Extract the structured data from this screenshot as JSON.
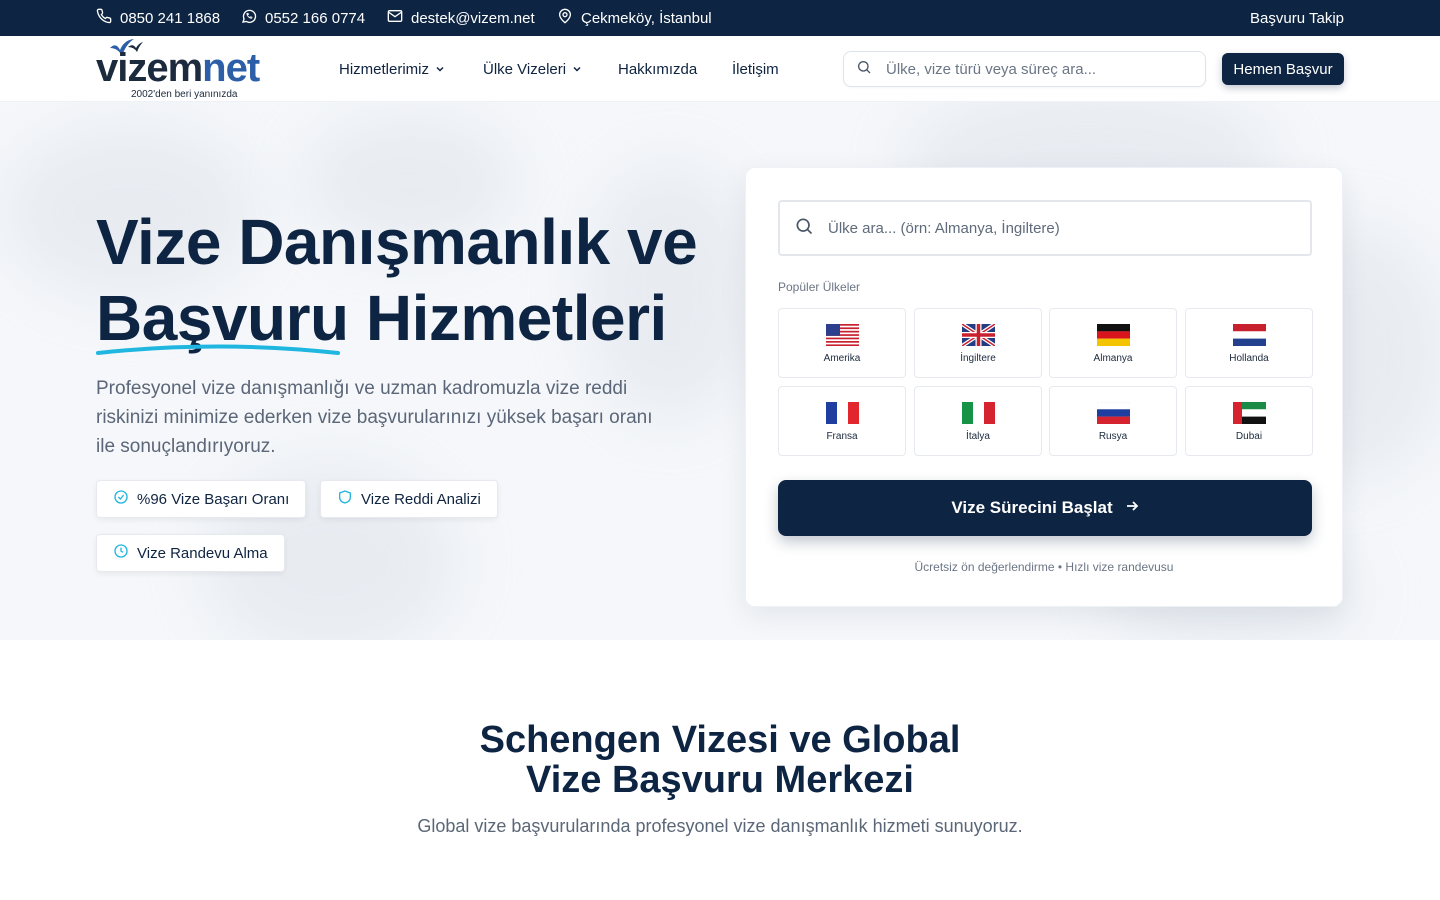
{
  "topbar": {
    "phone1": "0850 241 1868",
    "phone2": "0552 166 0774",
    "email": "destek@vizem.net",
    "location": "Çekmeköy, İstanbul",
    "track": "Başvuru Takip"
  },
  "logo": {
    "part1": "vizem",
    "part2": "net",
    "tagline": "2002'den beri yanınızda"
  },
  "nav": {
    "items": [
      "Hizmetlerimiz",
      "Ülke Vizeleri",
      "Hakkımızda",
      "İletişim"
    ],
    "search_placeholder": "Ülke, vize türü veya süreç ara...",
    "cta": "Hemen Başvur"
  },
  "hero": {
    "title_line1": "Vize Danışmanlık ve",
    "title_line2_highlight": "Başvuru",
    "title_line2_rest": " Hizmetleri",
    "lead": "Profesyonel vize danışmanlığı ve uzman kadromuzla vize reddi riskinizi minimize ederken vize başvurularınızı yüksek başarı oranı ile sonuçlandırıyoruz.",
    "chips": [
      "%96 Vize Başarı Oranı",
      "Vize Reddi Analizi",
      "Vize Randevu Alma"
    ]
  },
  "card": {
    "search_placeholder": "Ülke ara... (örn: Almanya, İngiltere)",
    "popular_label": "Popüler Ülkeler",
    "countries": [
      "Amerika",
      "İngiltere",
      "Almanya",
      "Hollanda",
      "Fransa",
      "İtalya",
      "Rusya",
      "Dubai"
    ],
    "cta": "Vize Sürecini Başlat",
    "note": "Ücretsiz ön değerlendirme • Hızlı vize randevusu"
  },
  "section": {
    "title_line1": "Schengen Vizesi ve Global",
    "title_line2": "Vize Başvuru Merkezi",
    "subtitle": "Global vize başvurularında profesyonel vize danışmanlık hizmeti sunuyoruz."
  },
  "colors": {
    "navy": "#0d2442",
    "accent": "#1fb6e0",
    "logo_blue": "#2c5fa8"
  }
}
